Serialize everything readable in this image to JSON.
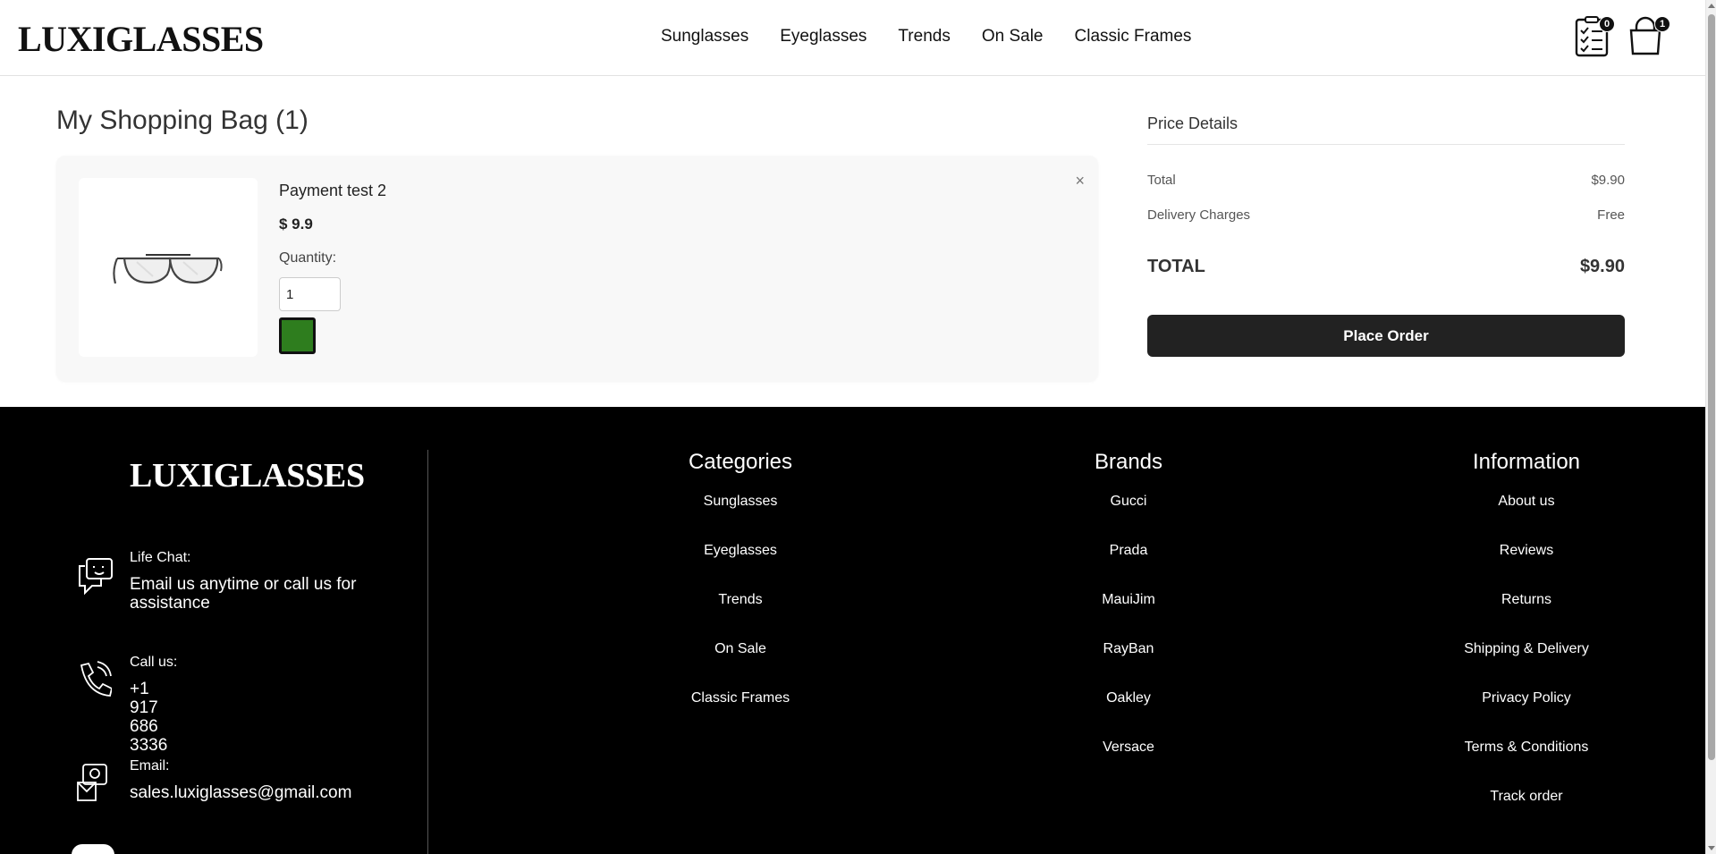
{
  "header": {
    "logo": "LUXIGLASSES",
    "nav": [
      "Sunglasses",
      "Eyeglasses",
      "Trends",
      "On Sale",
      "Classic Frames"
    ],
    "wishlist_count": "0",
    "cart_count": "1"
  },
  "bag": {
    "title": "My Shopping Bag (1)",
    "item": {
      "name": "Payment test 2",
      "price": "$ 9.9",
      "quantity_label": "Quantity:",
      "quantity": "1",
      "remove": "×",
      "color": "#2e7d1e"
    }
  },
  "price_details": {
    "title": "Price Details",
    "total_label": "Total",
    "total_value": "$9.90",
    "delivery_label": "Delivery Charges",
    "delivery_value": "Free",
    "grand_label": "TOTAL",
    "grand_value": "$9.90",
    "place_order": "Place Order"
  },
  "footer": {
    "logo": "LUXIGLASSES",
    "contact": {
      "chat_label": "Life Chat:",
      "chat_value": "Email us anytime or call us for assistance",
      "call_label": "Call us:",
      "call_value": "+1 917 686 3336",
      "email_label": "Email:",
      "email_value": "sales.luxiglasses@gmail.com"
    },
    "categories": {
      "title": "Categories",
      "items": [
        "Sunglasses",
        "Eyeglasses",
        "Trends",
        "On Sale",
        "Classic Frames"
      ]
    },
    "brands": {
      "title": "Brands",
      "items": [
        "Gucci",
        "Prada",
        "MauiJim",
        "RayBan",
        "Oakley",
        "Versace"
      ]
    },
    "information": {
      "title": "Information",
      "items": [
        "About us",
        "Reviews",
        "Returns",
        "Shipping & Delivery",
        "Privacy Policy",
        "Terms & Conditions",
        "Track order"
      ]
    }
  }
}
